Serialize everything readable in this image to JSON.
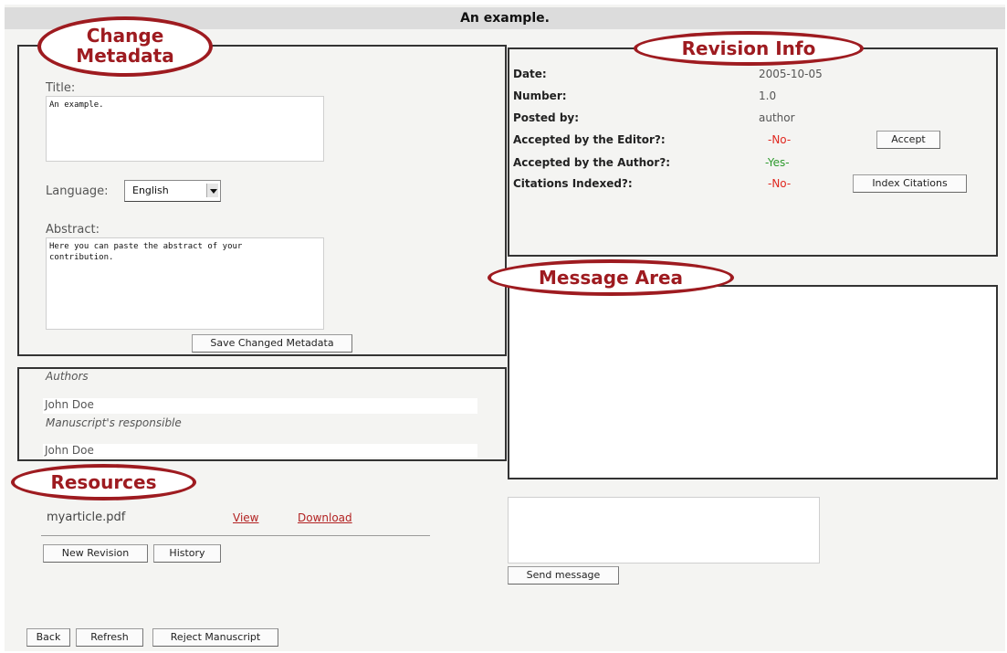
{
  "header": {
    "title": "An example."
  },
  "callouts": {
    "change_metadata": "Change\nMetadata",
    "revision_info": "Revision Info",
    "message_area": "Message Area",
    "resources": "Resources"
  },
  "metadata": {
    "title_label": "Title:",
    "title_value": "An example.",
    "language_label": "Language:",
    "language_value": "English",
    "abstract_label": "Abstract:",
    "abstract_value": "Here you can paste the abstract of your\ncontribution.",
    "save_button": "Save Changed Metadata"
  },
  "authors": {
    "heading": "Authors",
    "author1": "John Doe",
    "responsible_heading": "Manuscript's responsible",
    "author2": "John Doe"
  },
  "revision_info": {
    "rows": [
      {
        "label": "Date:",
        "value": "2005-10-05"
      },
      {
        "label": "Number:",
        "value": "1.0"
      },
      {
        "label": "Posted by:",
        "value": "author"
      },
      {
        "label": "Accepted by the Editor?:",
        "value": "-No-",
        "button": "Accept"
      },
      {
        "label": "Accepted by the Author?:",
        "value": "-Yes-"
      },
      {
        "label": "Citations Indexed?:",
        "value": "-No-",
        "button": "Index Citations"
      }
    ]
  },
  "resources": {
    "file_name": "myarticle.pdf",
    "view_link": "View",
    "download_link": "Download",
    "new_revision_button": "New Revision",
    "history_button": "History"
  },
  "message": {
    "input_value": "",
    "send_button": "Send message"
  },
  "footer": {
    "back_button": "Back",
    "refresh_button": "Refresh",
    "reject_button": "Reject Manuscript"
  },
  "colors": {
    "callout": "#9e1b20",
    "no": "#e0271f",
    "yes": "#2e9a2e",
    "link": "#b22222"
  }
}
